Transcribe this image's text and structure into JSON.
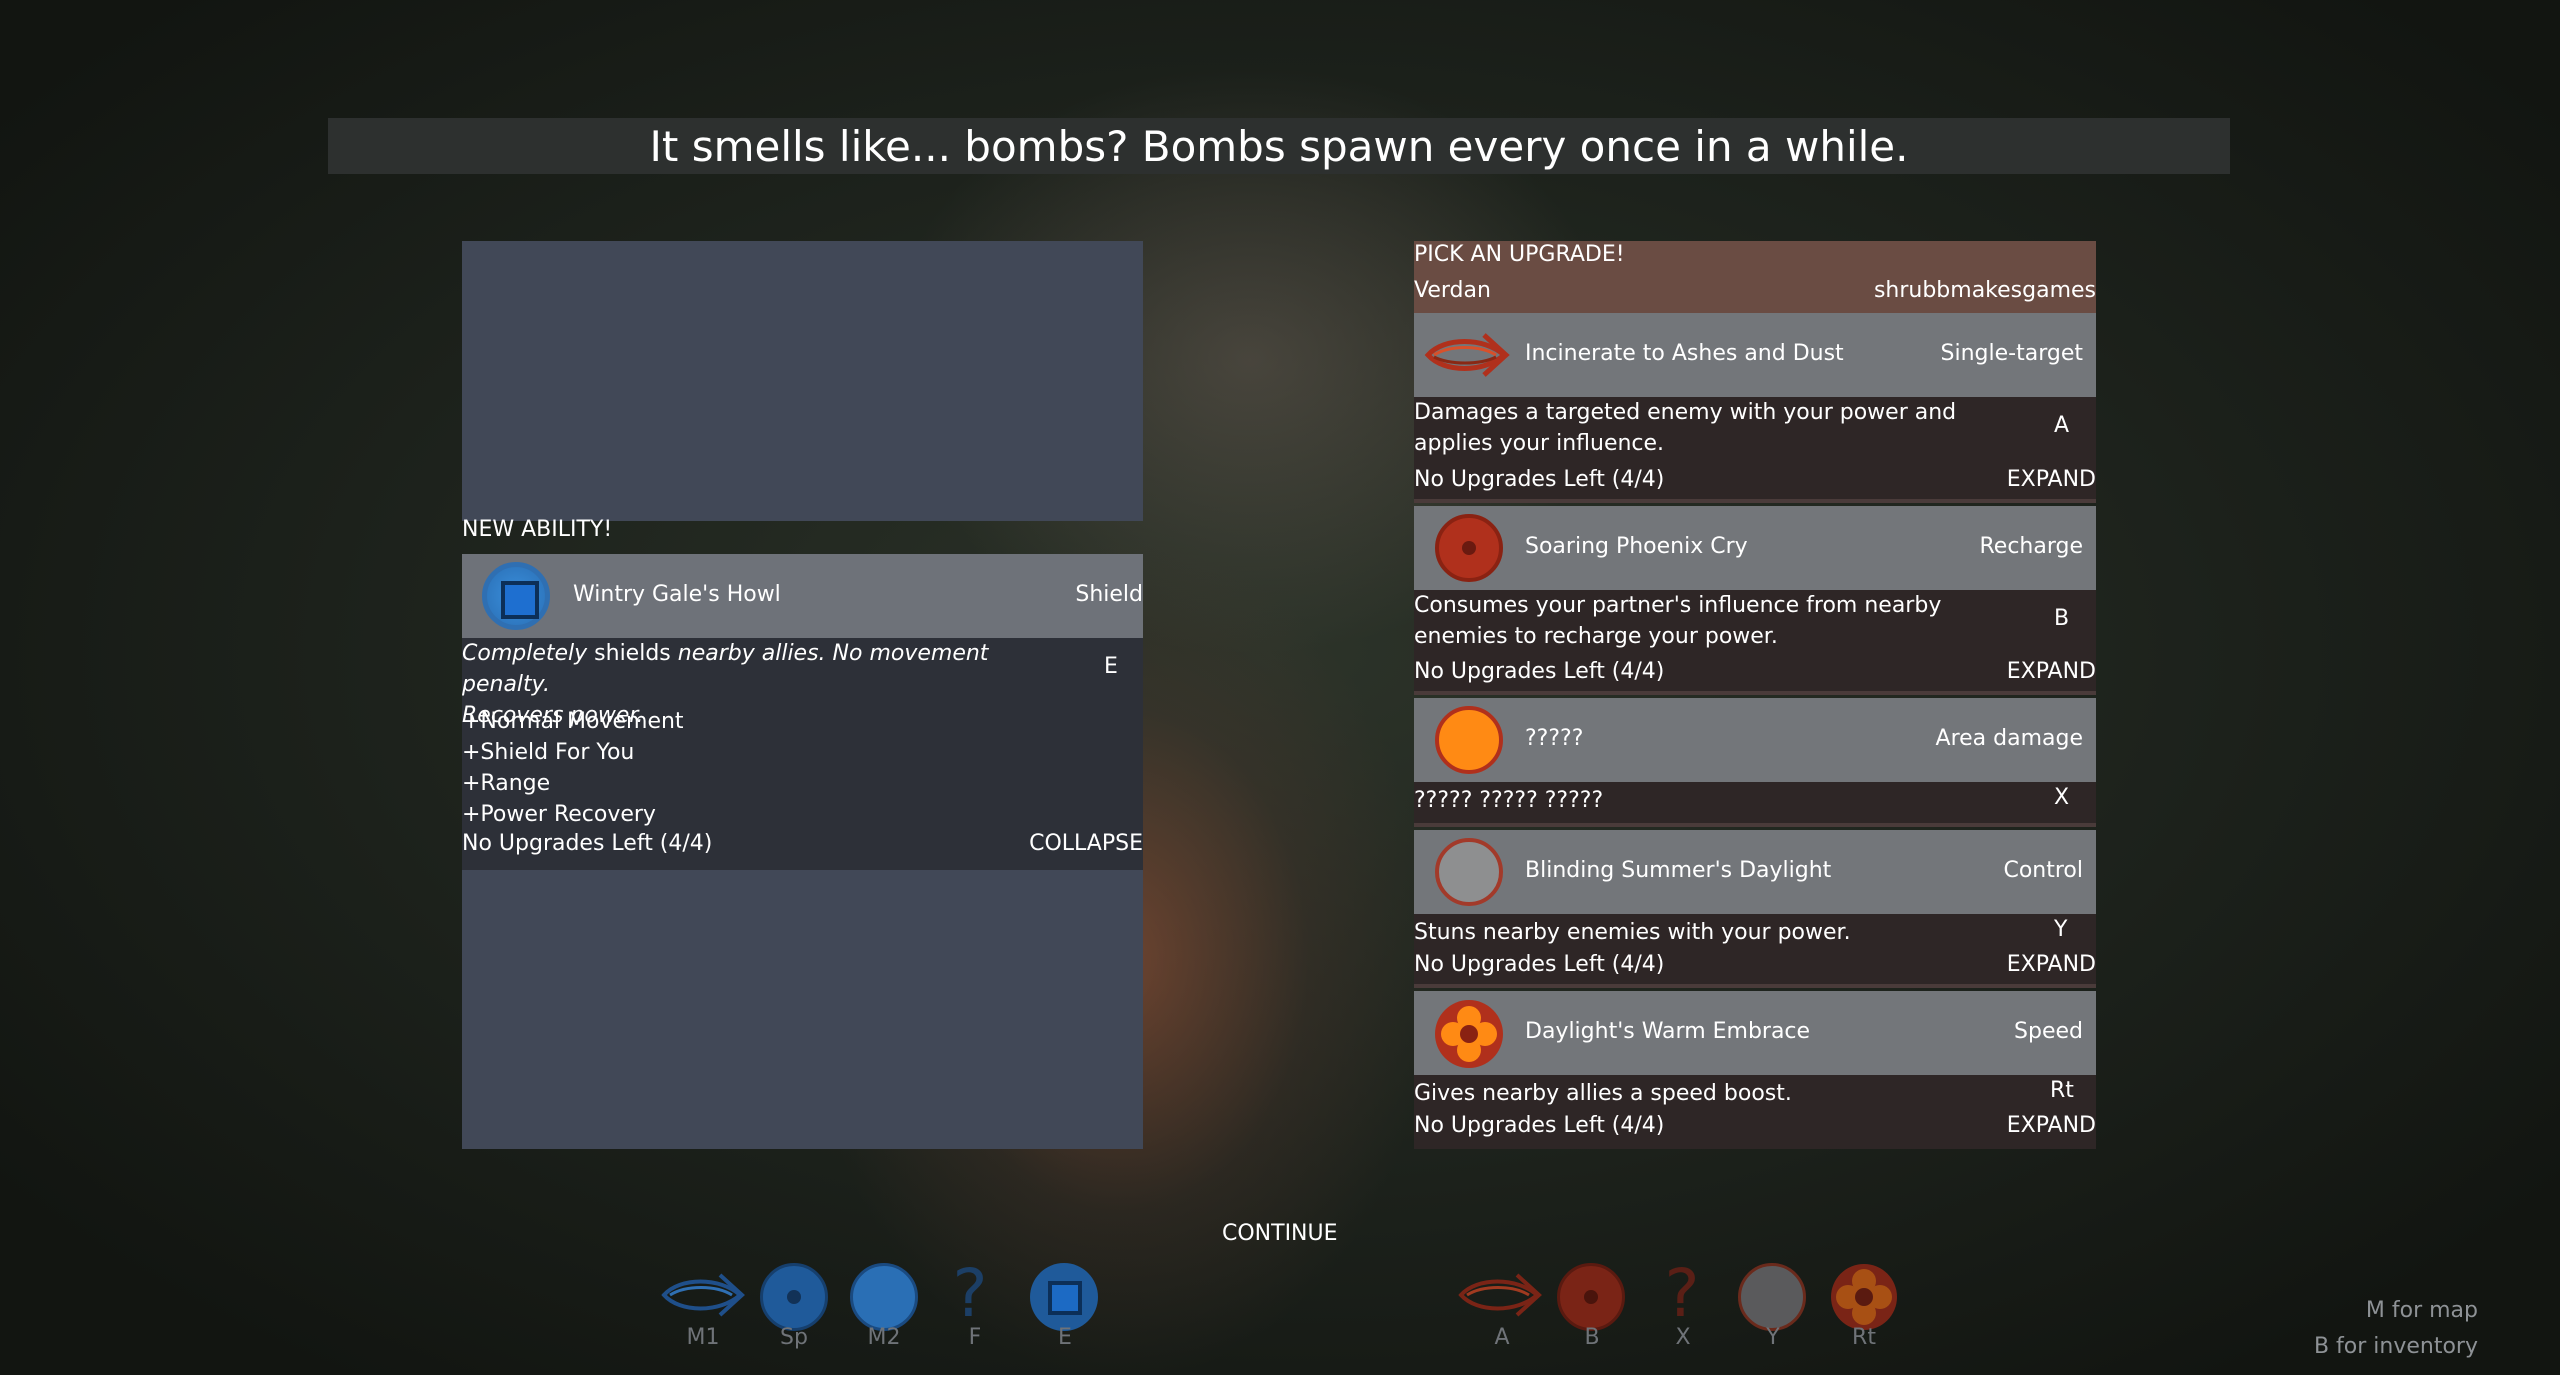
{
  "banner": {
    "text": "It smells like... bombs? Bombs spawn every once in a while."
  },
  "left_panel": {
    "new_ability_label": "NEW ABILITY!",
    "ability": {
      "name": "Wintry Gale's Howl",
      "type": "Shield",
      "desc_part1": "Completely",
      "desc_part2": " shields ",
      "desc_part3": "nearby allies. No movement penalty.",
      "desc_part4": "Recovers power.",
      "key": "E",
      "perks": [
        "+Normal Movement",
        "+Shield For You",
        "+Range",
        "+Power Recovery"
      ],
      "upgrades": "No Upgrades Left (4/4)",
      "toggle": "COLLAPSE",
      "icon": "blue-square-shield-icon"
    }
  },
  "right_panel": {
    "header": "PICK AN UPGRADE!",
    "character": "Verdan",
    "author": "shrubbmakesgames",
    "abilities": [
      {
        "name": "Incinerate to Ashes and Dust",
        "type": "Single-target",
        "desc": "Damages a targeted enemy with your power and applies your influence.",
        "key": "A",
        "upgrades": "No Upgrades Left (4/4)",
        "toggle": "EXPAND",
        "icon": "fire-swirl-icon"
      },
      {
        "name": "Soaring Phoenix Cry",
        "type": "Recharge",
        "desc": "Consumes your partner's influence from nearby enemies to recharge your power.",
        "key": "B",
        "upgrades": "No Upgrades Left (4/4)",
        "toggle": "EXPAND",
        "icon": "red-dot-circle-icon"
      },
      {
        "name": "?????",
        "type": "Area damage",
        "desc": "????? ????? ?????",
        "key": "X",
        "icon": "orange-circle-icon"
      },
      {
        "name": "Blinding Summer's Daylight",
        "type": "Control",
        "desc": "Stuns nearby enemies with your power.",
        "key": "Y",
        "upgrades": "No Upgrades Left (4/4)",
        "toggle": "EXPAND",
        "icon": "gray-circle-icon"
      },
      {
        "name": "Daylight's Warm Embrace",
        "type": "Speed",
        "desc": "Gives nearby allies  a speed boost.",
        "key": "Rt",
        "upgrades": "No Upgrades Left (4/4)",
        "toggle": "EXPAND",
        "icon": "flower-icon"
      }
    ]
  },
  "continue_label": "CONTINUE",
  "ability_bar_left": [
    "M1",
    "Sp",
    "M2",
    "F",
    "E"
  ],
  "ability_bar_right": [
    "A",
    "B",
    "X",
    "Y",
    "Rt"
  ],
  "hints": {
    "map": "M for map",
    "inventory": "B for inventory"
  },
  "colors": {
    "left_panel": "#414857",
    "right_header": "#6a4c43",
    "ability_row": "#73767a",
    "fire_red": "#b0301c",
    "orange": "#ff8a14",
    "blue": "#2f8ee0"
  }
}
